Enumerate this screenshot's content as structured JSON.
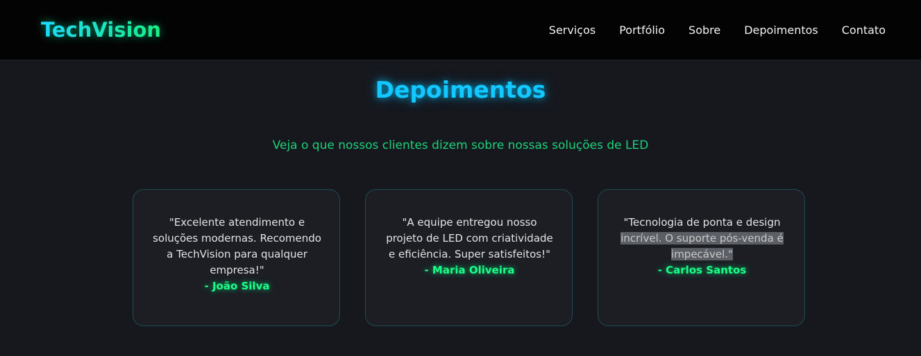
{
  "brand": {
    "name": "TechVision"
  },
  "nav": {
    "items": [
      {
        "label": "Serviços"
      },
      {
        "label": "Portfólio"
      },
      {
        "label": "Sobre"
      },
      {
        "label": "Depoimentos"
      },
      {
        "label": "Contato"
      }
    ]
  },
  "section": {
    "title": "Depoimentos",
    "subtitle": "Veja o que nossos clientes dizem sobre nossas soluções de LED"
  },
  "testimonials": [
    {
      "quote": "\"Excelente atendimento e soluções modernas. Recomendo a TechVision para qualquer empresa!\"",
      "author": "- João Silva"
    },
    {
      "quote": "\"A equipe entregou nosso projeto de LED com criatividade e eficiência. Super satisfeitos!\"",
      "author": "- Maria Oliveira"
    },
    {
      "quote_start": "\"Tecnologia de ponta e design ",
      "quote_selected": "incrível. O suporte pós-venda é impecável.\"",
      "author": "- Carlos Santos"
    }
  ],
  "colors": {
    "background": "#16181e",
    "navbar": "#030303",
    "accent_cyan": "#12c8ff",
    "accent_green": "#1aff87",
    "card_border": "#1e4c54"
  }
}
